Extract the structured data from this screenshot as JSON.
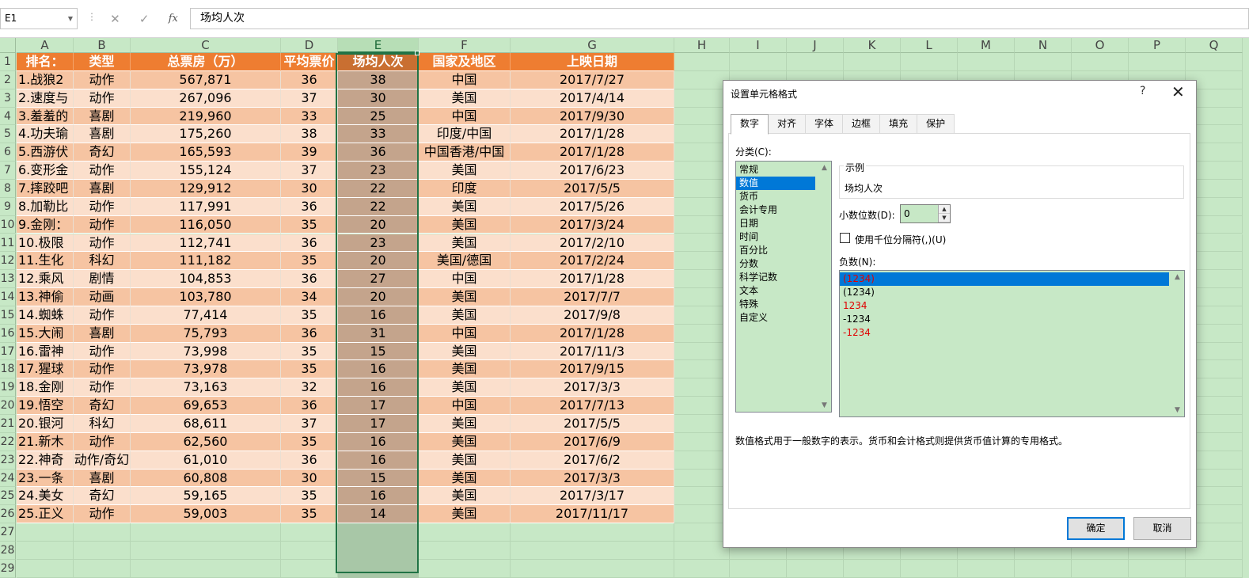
{
  "formula_bar": {
    "name_box": "E1",
    "cancel_icon": "✕",
    "enter_icon": "✓",
    "fx_label": "fx",
    "content": "场均人次"
  },
  "columns": [
    "A",
    "B",
    "C",
    "D",
    "E",
    "F",
    "G",
    "H",
    "I",
    "J",
    "K",
    "L",
    "M",
    "N",
    "O",
    "P",
    "Q"
  ],
  "selected_column": "E",
  "rows": [
    "1",
    "2",
    "3",
    "4",
    "5",
    "6",
    "7",
    "8",
    "9",
    "10",
    "11",
    "12",
    "13",
    "14",
    "15",
    "16",
    "17",
    "18",
    "19",
    "20",
    "21",
    "22",
    "23",
    "24",
    "25",
    "26",
    "27",
    "28",
    "29"
  ],
  "header": [
    "排名：",
    "类型",
    "总票房（万）",
    "平均票价",
    "场均人次",
    "国家及地区",
    "上映日期"
  ],
  "data": [
    [
      "1.战狼2",
      "动作",
      "567,871",
      "36",
      "38",
      "中国",
      "2017/7/27"
    ],
    [
      "2.速度与",
      "动作",
      "267,096",
      "37",
      "30",
      "美国",
      "2017/4/14"
    ],
    [
      "3.羞羞的",
      "喜剧",
      "219,960",
      "33",
      "25",
      "中国",
      "2017/9/30"
    ],
    [
      "4.功夫瑜",
      "喜剧",
      "175,260",
      "38",
      "33",
      "印度/中国",
      "2017/1/28"
    ],
    [
      "5.西游伏",
      "奇幻",
      "165,593",
      "39",
      "36",
      "中国香港/中国",
      "2017/1/28"
    ],
    [
      "6.变形金",
      "动作",
      "155,124",
      "37",
      "23",
      "美国",
      "2017/6/23"
    ],
    [
      "7.摔跤吧",
      "喜剧",
      "129,912",
      "30",
      "22",
      "印度",
      "2017/5/5"
    ],
    [
      "8.加勒比",
      "动作",
      "117,991",
      "36",
      "22",
      "美国",
      "2017/5/26"
    ],
    [
      "9.金刚：",
      "动作",
      "116,050",
      "35",
      "20",
      "美国",
      "2017/3/24"
    ],
    [
      "10.极限",
      "动作",
      "112,741",
      "36",
      "23",
      "美国",
      "2017/2/10"
    ],
    [
      "11.生化",
      "科幻",
      "111,182",
      "35",
      "20",
      "美国/德国",
      "2017/2/24"
    ],
    [
      "12.乘风",
      "剧情",
      "104,853",
      "36",
      "27",
      "中国",
      "2017/1/28"
    ],
    [
      "13.神偷",
      "动画",
      "103,780",
      "34",
      "20",
      "美国",
      "2017/7/7"
    ],
    [
      "14.蜘蛛",
      "动作",
      "77,414",
      "35",
      "16",
      "美国",
      "2017/9/8"
    ],
    [
      "15.大闹",
      "喜剧",
      "75,793",
      "36",
      "31",
      "中国",
      "2017/1/28"
    ],
    [
      "16.雷神",
      "动作",
      "73,998",
      "35",
      "15",
      "美国",
      "2017/11/3"
    ],
    [
      "17.猩球",
      "动作",
      "73,978",
      "35",
      "16",
      "美国",
      "2017/9/15"
    ],
    [
      "18.金刚",
      "动作",
      "73,163",
      "32",
      "16",
      "美国",
      "2017/3/3"
    ],
    [
      "19.悟空",
      "奇幻",
      "69,653",
      "36",
      "17",
      "中国",
      "2017/7/13"
    ],
    [
      "20.银河",
      "科幻",
      "68,611",
      "37",
      "17",
      "美国",
      "2017/5/5"
    ],
    [
      "21.新木",
      "动作",
      "62,560",
      "35",
      "16",
      "美国",
      "2017/6/9"
    ],
    [
      "22.神奇",
      "动作/奇幻",
      "61,010",
      "36",
      "16",
      "美国",
      "2017/6/2"
    ],
    [
      "23.一条",
      "喜剧",
      "60,808",
      "30",
      "15",
      "美国",
      "2017/3/3"
    ],
    [
      "24.美女",
      "奇幻",
      "59,165",
      "35",
      "16",
      "美国",
      "2017/3/17"
    ],
    [
      "25.正义",
      "动作",
      "59,003",
      "35",
      "14",
      "美国",
      "2017/11/17"
    ]
  ],
  "dialog": {
    "title": "设置单元格格式",
    "help": "?",
    "close": "✕",
    "tabs": [
      "数字",
      "对齐",
      "字体",
      "边框",
      "填充",
      "保护"
    ],
    "active_tab": "数字",
    "category_label": "分类(C):",
    "categories": [
      "常规",
      "数值",
      "货币",
      "会计专用",
      "日期",
      "时间",
      "百分比",
      "分数",
      "科学记数",
      "文本",
      "特殊",
      "自定义"
    ],
    "selected_category": "数值",
    "sample_legend": "示例",
    "sample_value": "场均人次",
    "decimals_label": "小数位数(D):",
    "decimals_value": "0",
    "thousands_label": "使用千位分隔符(,)(U)",
    "thousands_checked": false,
    "negative_label": "负数(N):",
    "negatives": [
      {
        "text": "(1234)",
        "red": true
      },
      {
        "text": "(1234)",
        "red": false
      },
      {
        "text": "1234",
        "red": true
      },
      {
        "text": "-1234",
        "red": false
      },
      {
        "text": "-1234",
        "red": true
      }
    ],
    "selected_negative": 0,
    "description": "数值格式用于一般数字的表示。货币和会计格式则提供货币值计算的专用格式。",
    "ok": "确定",
    "cancel": "取消"
  },
  "colors": {
    "header_fill": "#ee7d31",
    "row_odd": "#f6c4a2",
    "row_even": "#fbdfcc",
    "selection": "#217346",
    "sheet_bg": "#c7e8c6",
    "accent": "#0078d7",
    "negative_red": "#e00000"
  }
}
